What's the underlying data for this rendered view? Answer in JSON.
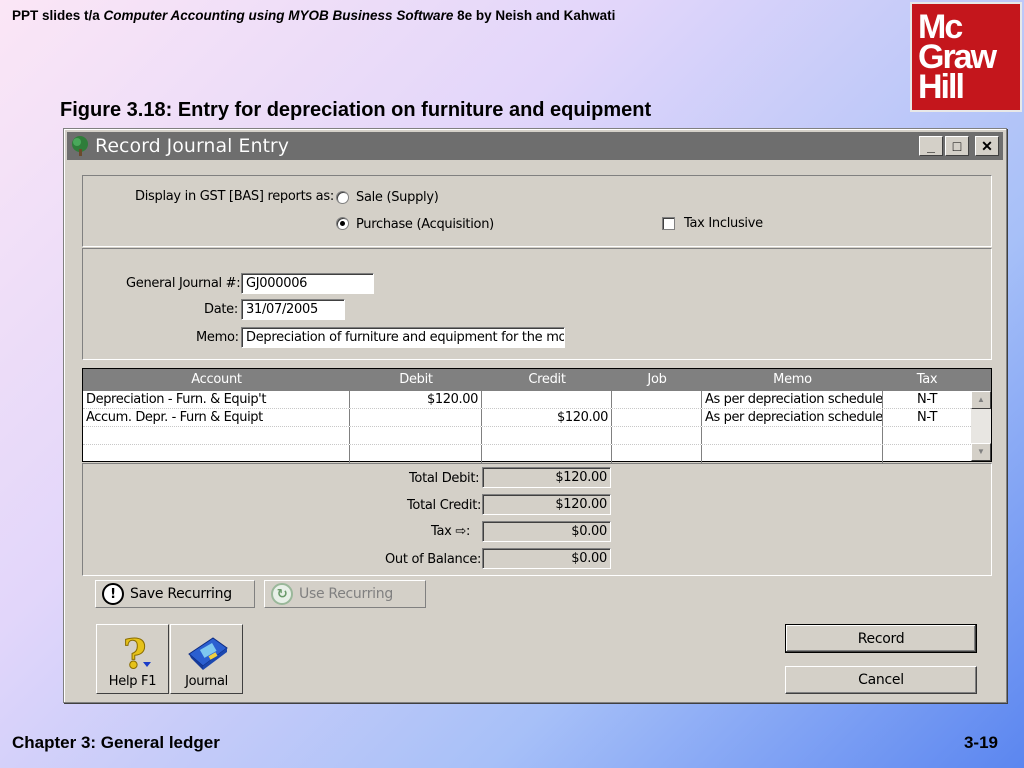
{
  "slide": {
    "header_prefix": "PPT slides t/a ",
    "header_book": "Computer Accounting using MYOB Business Software",
    "header_suffix": " 8e by Neish and Kahwati",
    "logo_lines": [
      "Mc",
      "Graw",
      "Hill"
    ],
    "figure_title": "Figure 3.18: Entry for depreciation on furniture and equipment",
    "footer": "Chapter 3: General ledger",
    "page_number": "3-19"
  },
  "window": {
    "title": "Record Journal Entry",
    "controls": {
      "minimize": "_",
      "maximize": "□",
      "close": "✕"
    }
  },
  "gst": {
    "label": "Display in GST [BAS] reports as:",
    "options": [
      "Sale (Supply)",
      "Purchase (Acquisition)"
    ],
    "selected": "Purchase (Acquisition)",
    "tax_inclusive_label": "Tax Inclusive",
    "tax_inclusive_checked": false
  },
  "form": {
    "journal_label": "General Journal #:",
    "journal_value": "GJ000006",
    "date_label": "Date:",
    "date_value": "31/07/2005",
    "memo_label": "Memo:",
    "memo_value": "Depreciation of furniture and equipment for the month"
  },
  "grid": {
    "columns": [
      "Account",
      "Debit",
      "Credit",
      "Job",
      "Memo",
      "Tax"
    ],
    "rows": [
      {
        "account": "Depreciation - Furn. & Equip't",
        "debit": "$120.00",
        "credit": "",
        "job": "",
        "memo": "As per depreciation schedule",
        "tax": "N-T"
      },
      {
        "account": "Accum. Depr. - Furn & Equipt",
        "debit": "",
        "credit": "$120.00",
        "job": "",
        "memo": "As per depreciation schedule",
        "tax": "N-T"
      }
    ]
  },
  "totals": {
    "total_debit_label": "Total Debit:",
    "total_debit": "$120.00",
    "total_credit_label": "Total Credit:",
    "total_credit": "$120.00",
    "tax_label": "Tax",
    "tax_colon": ":",
    "tax": "$0.00",
    "out_of_balance_label": "Out of Balance:",
    "out_of_balance": "$0.00"
  },
  "buttons": {
    "save_recurring": "Save Recurring",
    "use_recurring": "Use Recurring",
    "help": "Help F1",
    "journal": "Journal",
    "record": "Record",
    "cancel": "Cancel"
  },
  "colors": {
    "logo_red": "#c4161c",
    "window_face": "#d4d0c8",
    "grid_header": "#808080"
  }
}
